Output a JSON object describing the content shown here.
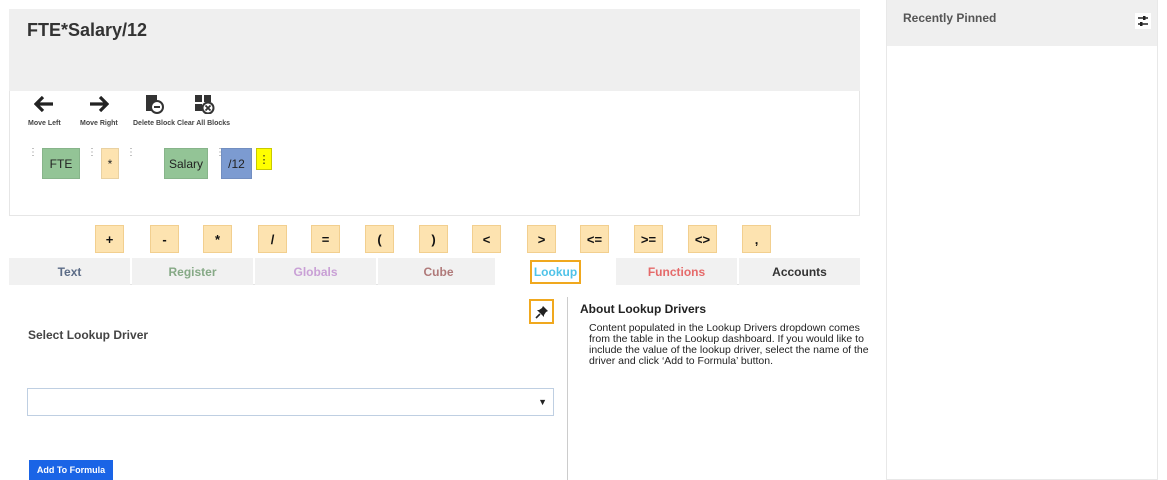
{
  "formula": {
    "title": "FTE*Salary/12"
  },
  "toolbar": [
    {
      "name": "move-left",
      "label": "Move Left",
      "icon": "arrow-left-icon"
    },
    {
      "name": "move-right",
      "label": "Move Right",
      "icon": "arrow-right-icon"
    },
    {
      "name": "delete-block",
      "label": "Delete Block",
      "icon": "delete-block-icon"
    },
    {
      "name": "clear-all-blocks",
      "label": "Clear All Blocks",
      "icon": "clear-all-blocks-icon"
    }
  ],
  "blocks": [
    {
      "text": "FTE",
      "color": "#93c496"
    },
    {
      "text": "*",
      "color": "#fde3b0"
    },
    {
      "text": "Salary",
      "color": "#93c496"
    },
    {
      "text": "/12",
      "color": "#7c9bd1"
    },
    {
      "text": "⋮",
      "color": "#ffff00"
    }
  ],
  "operators": [
    "+",
    "-",
    "*",
    "/",
    "=",
    "(",
    ")",
    "<",
    ">",
    "<=",
    ">=",
    "<>",
    ","
  ],
  "tabs": [
    {
      "label": "Text",
      "color": "#5b6b86",
      "active": false
    },
    {
      "label": "Register",
      "color": "#86a986",
      "active": false
    },
    {
      "label": "Globals",
      "color": "#c9a0d6",
      "active": false
    },
    {
      "label": "Cube",
      "color": "#b07a7a",
      "active": false
    },
    {
      "label": "Lookup",
      "color": "#4fc3e8",
      "active": true
    },
    {
      "label": "Functions",
      "color": "#e56a6a",
      "active": false
    },
    {
      "label": "Accounts",
      "color": "#333333",
      "active": false
    }
  ],
  "lookup": {
    "select_label": "Select Lookup Driver",
    "dropdown_value": "",
    "add_button": "Add To Formula",
    "about_title": "About Lookup Drivers",
    "about_body": "Content populated in the Lookup Drivers dropdown comes from the table in the Lookup dashboard. If you would like to include the value of the lookup driver, select the name of the driver and click ‘Add to Formula’ button."
  },
  "right_panel": {
    "title": "Recently Pinned",
    "icon": "settings-sliders-icon"
  },
  "colors": {
    "highlight": "#f0a81e",
    "button_blue": "#1a64e6",
    "operator_bg": "#fde3b0"
  }
}
